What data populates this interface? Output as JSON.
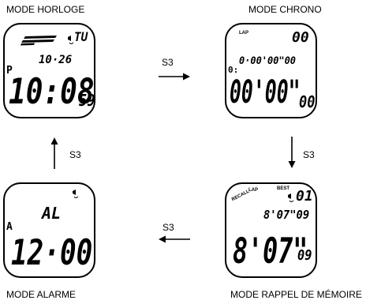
{
  "modes": {
    "clock": {
      "caption": "MODE HORLOGE",
      "day": "TU",
      "date": "10·26",
      "pm": "P",
      "time": "10:08",
      "seconds": "59"
    },
    "chrono": {
      "caption": "MODE CHRONO",
      "lap_tag": "LAP",
      "lap_count": "00",
      "hour_prefix": "0:",
      "split": "0·00'00\"00",
      "main": "00'00\"",
      "hundredths": "00"
    },
    "alarm": {
      "caption": "MODE ALARME",
      "al": "AL",
      "a_tag": "A",
      "time": "12·00"
    },
    "recall": {
      "caption": "MODE RAPPEL DE MÉMOIRE",
      "recall_tag": "RECALL",
      "lap_tag": "LAP",
      "best_tag": "BEST",
      "lap_number": "01",
      "lap_time": "8'07\"09",
      "main": "8'07\"",
      "hundredths": "09"
    }
  },
  "transitions": {
    "clock_to_chrono": "S3",
    "chrono_to_recall": "S3",
    "recall_to_alarm": "S3",
    "alarm_to_clock": "S3"
  }
}
